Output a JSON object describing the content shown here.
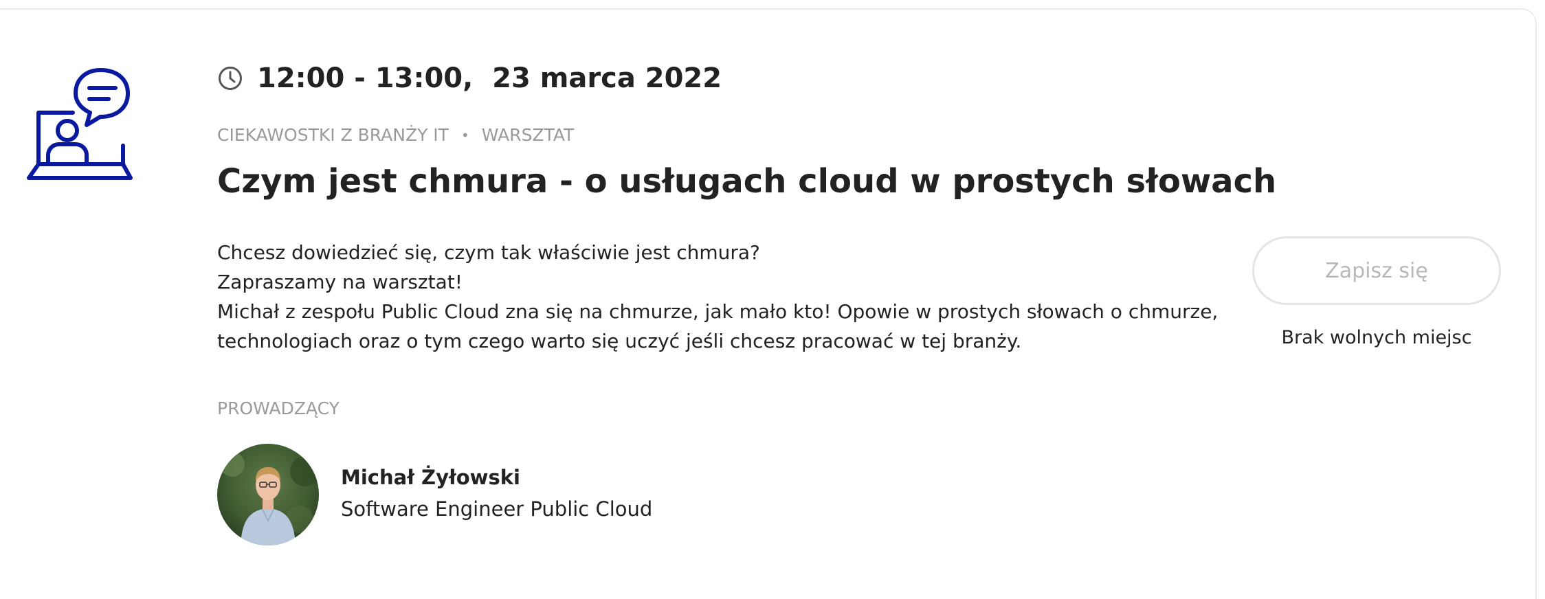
{
  "event": {
    "time": "12:00 - 13:00,  23 marca 2022",
    "categories": [
      "CIEKAWOSTKI Z BRANŻY IT",
      "WARSZTAT"
    ],
    "separator": "•",
    "title": "Czym jest chmura - o usługach cloud w prostych słowach",
    "description_lines": [
      "Chcesz dowiedzieć się, czym tak właściwie jest chmura?",
      "Zapraszamy na warsztat!",
      "Michał z zespołu Public Cloud zna się na chmurze, jak mało kto! Opowie w prostych słowach o chmurze,",
      "technologiach oraz o tym czego warto się uczyć jeśli chcesz pracować w tej branży."
    ]
  },
  "registration": {
    "button_label": "Zapisz się",
    "status": "Brak wolnych miejsc"
  },
  "host": {
    "section_label": "PROWADZĄCY",
    "name": "Michał Żyłowski",
    "role": "Software Engineer Public Cloud"
  },
  "icons": {
    "event": "online-presentation-chat-icon",
    "time": "clock-icon"
  },
  "colors": {
    "icon_blue": "#0a1aa0",
    "muted_text": "#9a9a9a",
    "disabled_button": "#b8b8b8"
  }
}
